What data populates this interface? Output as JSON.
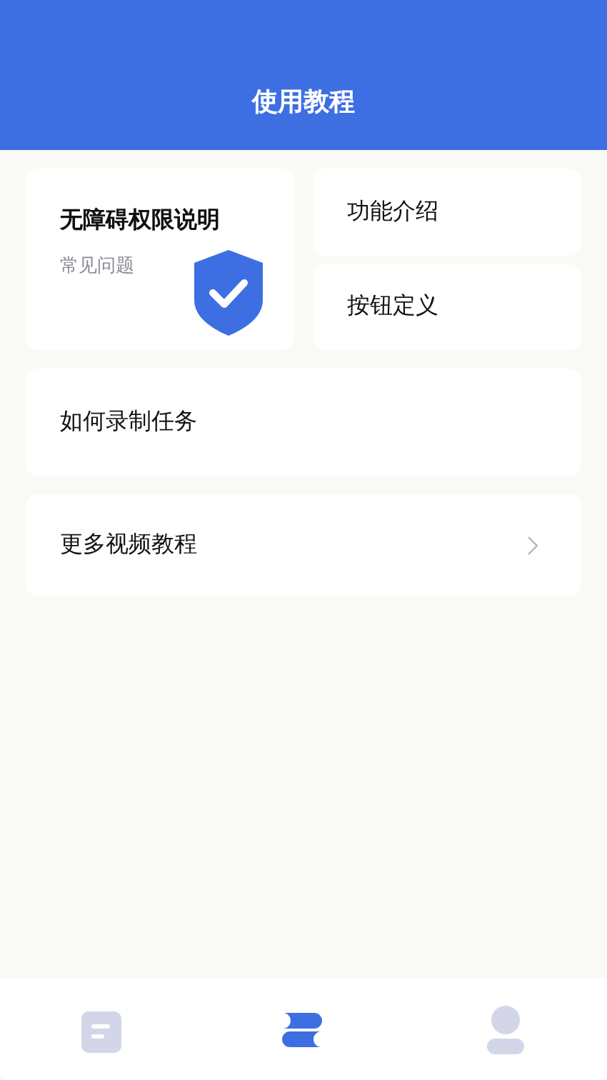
{
  "header": {
    "title": "使用教程"
  },
  "feature_card": {
    "title": "无障碍权限说明",
    "subtitle": "常见问题"
  },
  "side_cards": [
    {
      "label": "功能介绍"
    },
    {
      "label": "按钮定义"
    }
  ],
  "list_items": [
    {
      "label": "如何录制任务",
      "kind": "plain"
    },
    {
      "label": "更多视频教程",
      "kind": "link"
    }
  ],
  "nav_tabs": [
    {
      "kind": "document",
      "selected": false
    },
    {
      "kind": "tutorial",
      "selected": true
    },
    {
      "kind": "profile",
      "selected": false
    }
  ]
}
